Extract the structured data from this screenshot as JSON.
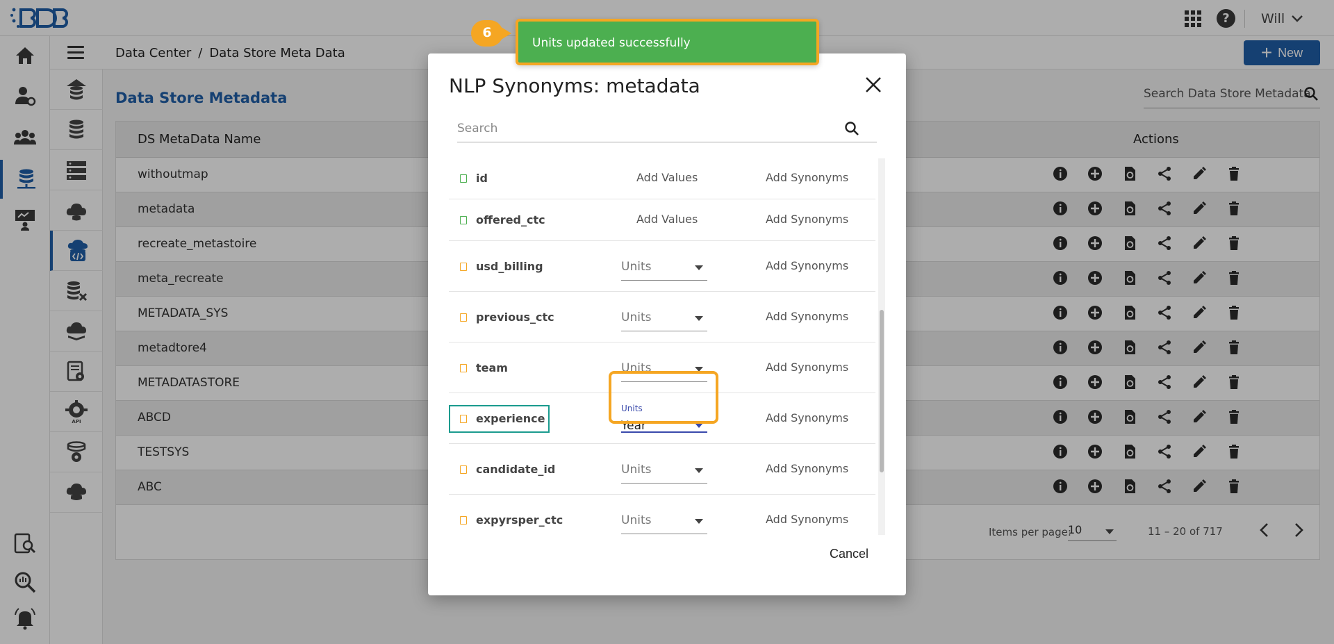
{
  "topbar": {
    "user_name": "Will"
  },
  "breadcrumb": {
    "items": [
      "Data Center",
      "/",
      "Data Store Meta Data"
    ]
  },
  "toolbar": {
    "new_label": "New"
  },
  "main": {
    "title": "Data Store Metadata",
    "search_placeholder": "Search Data Store Metadata",
    "columns": {
      "name": "DS MetaData Name",
      "actions": "Actions"
    },
    "rows": [
      "withoutmap",
      "metadata",
      "recreate_metastoire",
      "meta_recreate",
      "METADATA_SYS",
      "metadtore4",
      "METADATASTORE",
      "ABCD",
      "TESTSYS",
      "ABC"
    ],
    "pager": {
      "items_per_page_label": "Items per page:",
      "items_per_page_value": "10",
      "range": "11 – 20 of 717"
    }
  },
  "dialog": {
    "title": "NLP Synonyms: metadata",
    "search_placeholder": "Search",
    "add_values_label": "Add Values",
    "add_synonyms_label": "Add Synonyms",
    "units_label": "Units",
    "cancel_label": "Cancel",
    "fields": [
      {
        "name": "id",
        "mode": "values",
        "color": "#4caf50"
      },
      {
        "name": "offered_ctc",
        "mode": "values",
        "color": "#4caf50"
      },
      {
        "name": "usd_billing",
        "mode": "units",
        "color": "#f5a623"
      },
      {
        "name": "previous_ctc",
        "mode": "units",
        "color": "#f5a623"
      },
      {
        "name": "team",
        "mode": "units",
        "color": "#f5a623"
      },
      {
        "name": "experience",
        "mode": "units-selected",
        "value": "Year",
        "color": "#f5a623"
      },
      {
        "name": "candidate_id",
        "mode": "units",
        "color": "#f5a623"
      },
      {
        "name": "expyrsper_ctc",
        "mode": "units",
        "color": "#f5a623"
      }
    ]
  },
  "toast": {
    "message": "Units updated successfully",
    "step": "6"
  },
  "colors": {
    "accent": "#1f5fa8",
    "toast": "#4caf50",
    "highlight": "#f5a623",
    "focus": "#3949ab"
  }
}
